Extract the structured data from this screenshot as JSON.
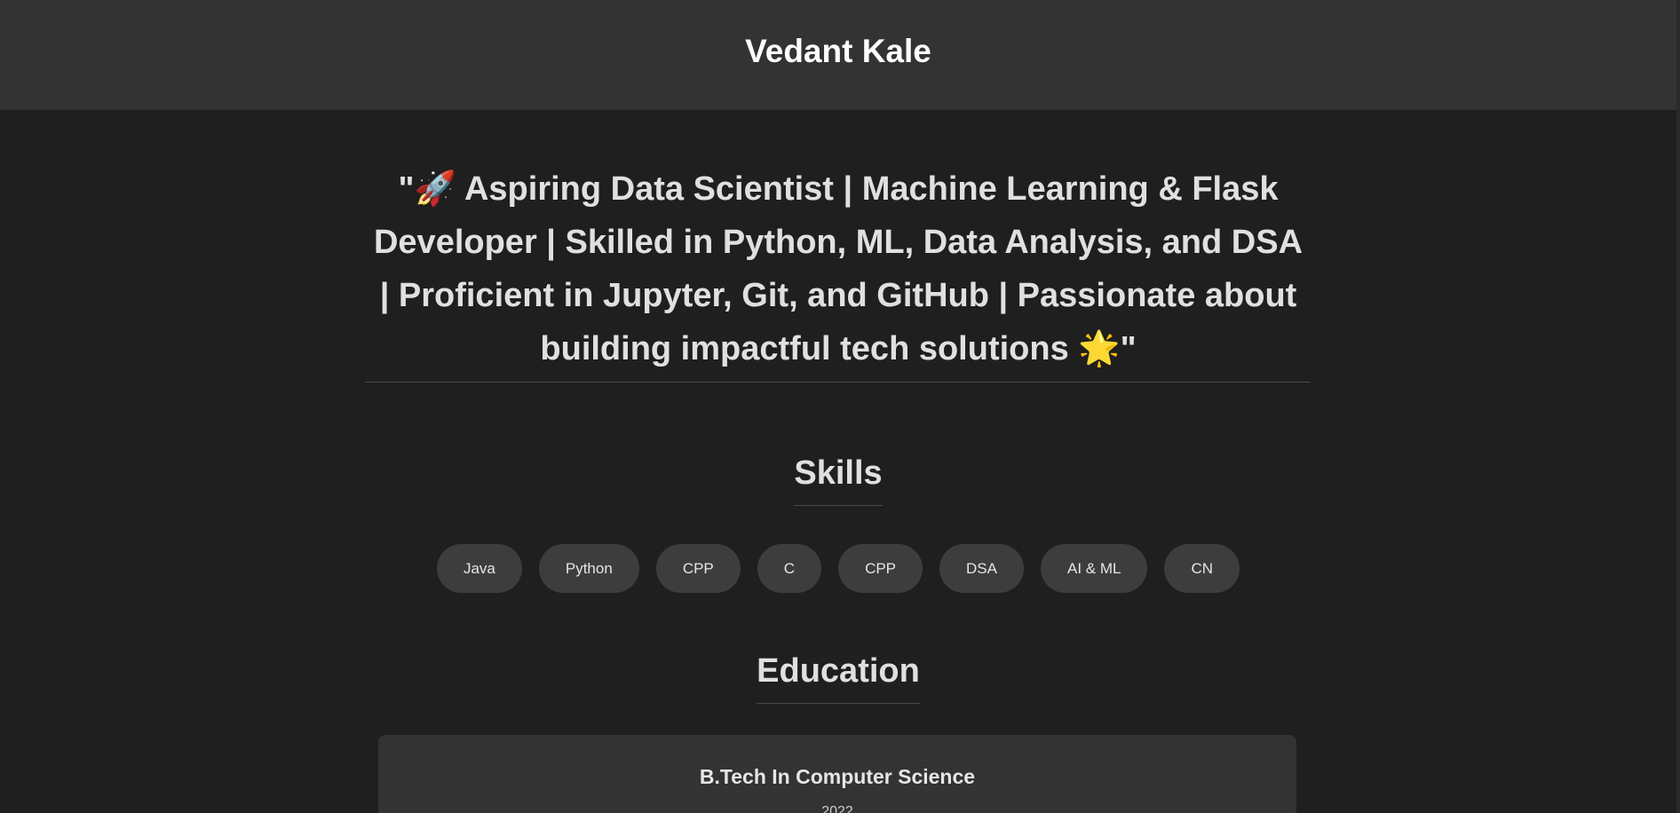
{
  "header": {
    "name": "Vedant Kale"
  },
  "tagline": {
    "text": "\"🚀 Aspiring Data Scientist | Machine Learning & Flask Developer | Skilled in Python, ML, Data Analysis, and DSA | Proficient in Jupyter, Git, and GitHub | Passionate about building impactful tech solutions 🌟\""
  },
  "skills": {
    "title": "Skills",
    "items": [
      {
        "label": "Java"
      },
      {
        "label": "Python"
      },
      {
        "label": "CPP"
      },
      {
        "label": "C"
      },
      {
        "label": "CPP"
      },
      {
        "label": "DSA"
      },
      {
        "label": "AI & ML"
      },
      {
        "label": "CN"
      }
    ]
  },
  "education": {
    "title": "Education",
    "cards": [
      {
        "degree": "B.Tech In Computer Science",
        "year": "2022"
      }
    ]
  },
  "colors": {
    "page_bg": "#1f1f1f",
    "header_bg": "#333333",
    "pill_bg": "#3d3d3d",
    "card_bg": "#333333",
    "text": "#e0e0e0"
  }
}
